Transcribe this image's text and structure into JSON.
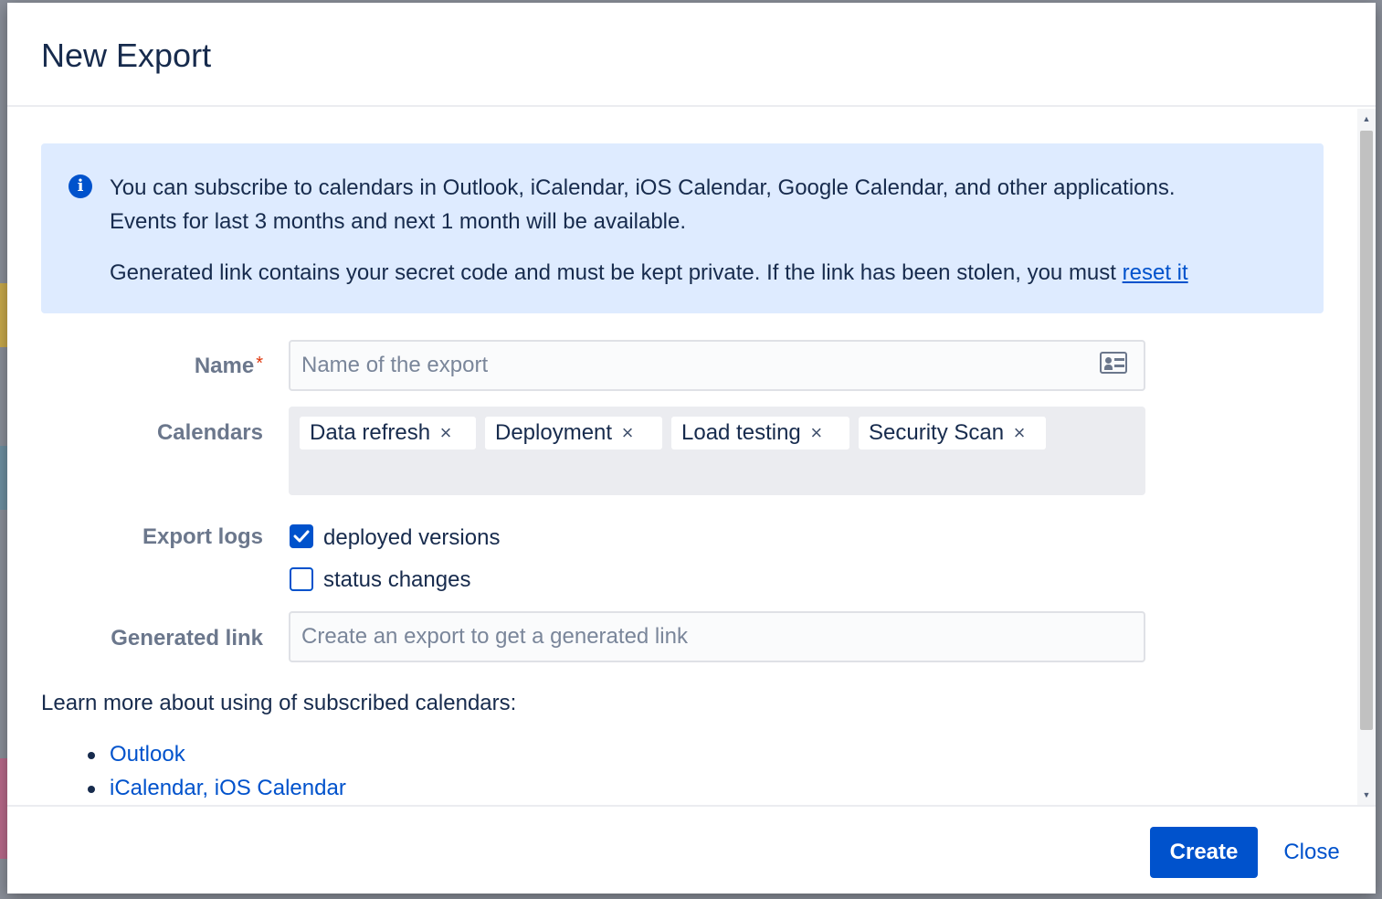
{
  "dialog": {
    "title": "New Export"
  },
  "info": {
    "line1": "You can subscribe to calendars in Outlook, iCalendar, iOS Calendar, Google Calendar, and other applications.",
    "line2": "Events for last 3 months and next 1 month will be available.",
    "line3": "Generated link contains your secret code and must be kept private. If the link has been stolen, you must ",
    "reset_link": "reset it"
  },
  "form": {
    "name_label": "Name",
    "name_required": "*",
    "name_placeholder": "Name of the export",
    "calendars_label": "Calendars",
    "calendars": [
      "Data refresh",
      "Deployment",
      "Load testing",
      "Security Scan"
    ],
    "tag_remove": "×",
    "export_logs_label": "Export logs",
    "logs": [
      {
        "label": "deployed versions",
        "checked": true
      },
      {
        "label": "status changes",
        "checked": false
      }
    ],
    "generated_link_label": "Generated link",
    "generated_link_placeholder": "Create an export to get a generated link"
  },
  "learn_more": {
    "text": "Learn more about using of subscribed calendars:",
    "links": [
      "Outlook",
      "iCalendar, iOS Calendar"
    ]
  },
  "footer": {
    "create_label": "Create",
    "close_label": "Close"
  },
  "colors": {
    "primary": "#0052cc",
    "info_bg": "#deebff",
    "required": "#de350b"
  },
  "icons": {
    "info": "info-icon",
    "name_field": "contact-card-icon",
    "tag_remove": "close-icon",
    "checkbox": "check-icon"
  }
}
